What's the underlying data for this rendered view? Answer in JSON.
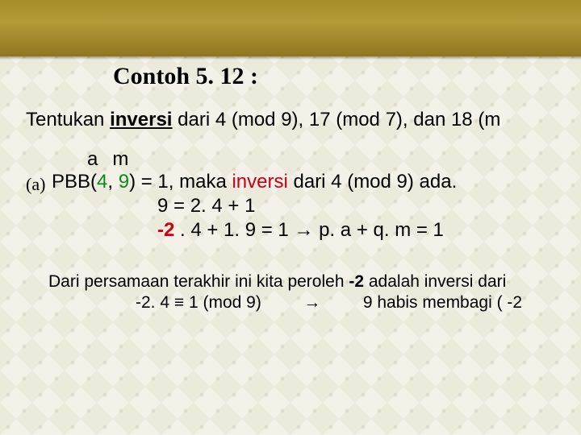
{
  "title": "Contoh  5. 12 :",
  "prompt": {
    "pre": "Tentukan ",
    "underlined": "inversi",
    "post": " dari 4 (mod 9), 17 (mod 7), dan 18 (m"
  },
  "am": {
    "a": "a",
    "m": "m"
  },
  "part_label": "(a)",
  "line_a": {
    "t1": "PBB(",
    "g1": "4",
    "t2": ", ",
    "g2": "9",
    "t3": ") = 1, maka ",
    "red": "inversi",
    "t4": " dari 4 (mod 9) ada."
  },
  "line_b": "9 = 2. 4 + 1",
  "line_c": {
    "neg2": "-2",
    "rest": " . 4 + 1. 9 = 1  ",
    "arrow": "→",
    "tail": "   p. a + q. m = 1"
  },
  "concl": {
    "t1": "Dari persamaan terakhir ini kita peroleh ",
    "neg2": "-2",
    "t2": " adalah inversi dari "
  },
  "concl2": {
    "left": "-2. 4 ≡ 1 (mod 9)",
    "arrow": "→",
    "right": "9 habis membagi ( -2"
  }
}
